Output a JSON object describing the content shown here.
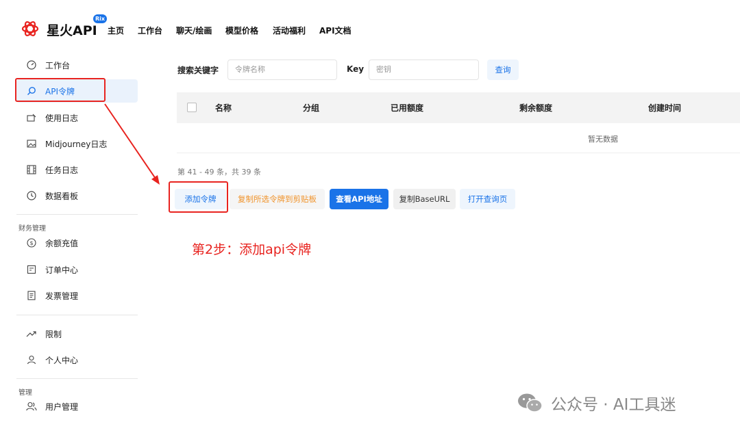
{
  "brand": {
    "name": "星火API",
    "badge": "Rix"
  },
  "nav": [
    "主页",
    "工作台",
    "聊天/绘画",
    "模型价格",
    "活动福利",
    "API文档"
  ],
  "sidebar": {
    "items": [
      {
        "label": "工作台",
        "icon": "dashboard-icon"
      },
      {
        "label": "API令牌",
        "icon": "search-icon",
        "active": true
      },
      {
        "label": "使用日志",
        "icon": "log-icon"
      },
      {
        "label": "Midjourney日志",
        "icon": "image-icon"
      },
      {
        "label": "任务日志",
        "icon": "film-icon"
      },
      {
        "label": "数据看板",
        "icon": "clock-icon"
      }
    ],
    "finance_group": "财务管理",
    "finance_items": [
      {
        "label": "余额充值",
        "icon": "dollar-icon"
      },
      {
        "label": "订单中心",
        "icon": "order-icon"
      },
      {
        "label": "发票管理",
        "icon": "invoice-icon"
      }
    ],
    "misc_items": [
      {
        "label": "限制",
        "icon": "trend-icon"
      },
      {
        "label": "个人中心",
        "icon": "user-icon"
      }
    ],
    "admin_group": "管理",
    "admin_items": [
      {
        "label": "用户管理",
        "icon": "users-icon"
      }
    ]
  },
  "search": {
    "keyword_label": "搜索关键字",
    "keyword_placeholder": "令牌名称",
    "key_label": "Key",
    "key_placeholder": "密钥",
    "query_button": "查询"
  },
  "table": {
    "columns": [
      "名称",
      "分组",
      "已用额度",
      "剩余额度",
      "创建时间"
    ],
    "empty_text": "暂无数据",
    "pager": "第 41 - 49 条，共 39 条"
  },
  "actions": {
    "add": "添加令牌",
    "copy_selected": "复制所选令牌到剪贴板",
    "view_api": "查看API地址",
    "copy_base": "复制BaseURL",
    "open_query": "打开查询页"
  },
  "annotation": {
    "step": "第2步：添加api令牌"
  },
  "watermark": "公众号 · AI工具迷",
  "colors": {
    "accent": "#1a73e8",
    "annotation": "#e8231f",
    "warn": "#f0932b"
  }
}
